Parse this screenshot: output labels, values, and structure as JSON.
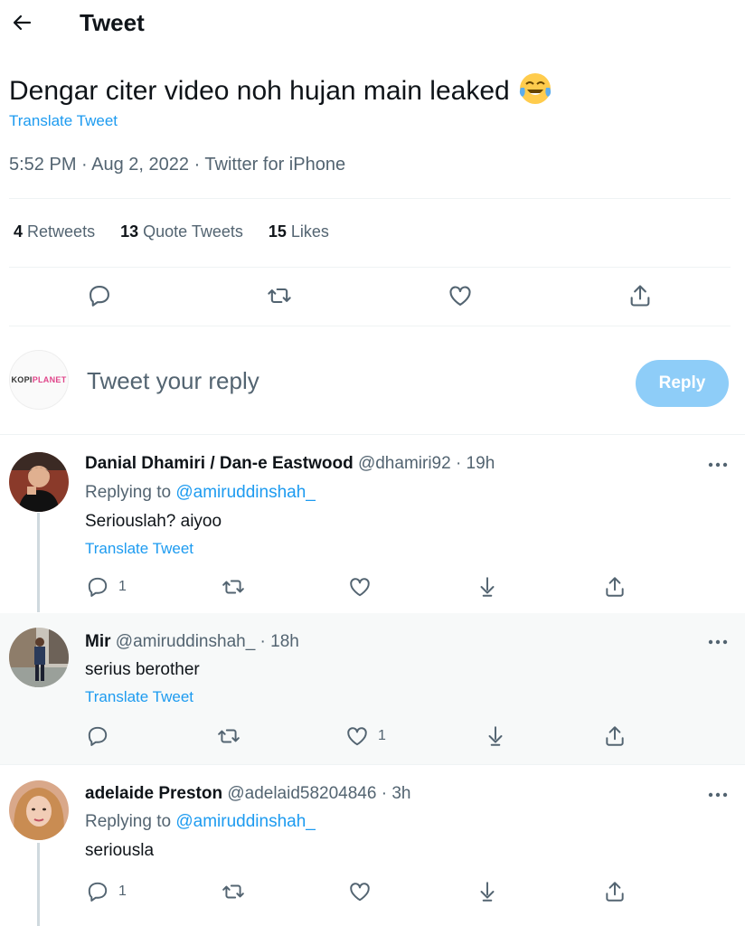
{
  "header": {
    "title": "Tweet",
    "back_icon": "arrow-left-icon"
  },
  "tweet": {
    "text": "Dengar citer video noh hujan main leaked",
    "emoji": "tears-of-joy-emoji",
    "translate": "Translate Tweet",
    "meta": "5:52 PM · Aug 2, 2022 · Twitter for iPhone",
    "stats": {
      "retweets_count": "4",
      "retweets_label": "Retweets",
      "quotes_count": "13",
      "quotes_label": "Quote Tweets",
      "likes_count": "15",
      "likes_label": "Likes"
    }
  },
  "reply_box": {
    "avatar_text_a": "KOPI",
    "avatar_text_b": "PLANET",
    "placeholder": "Tweet your reply",
    "button": "Reply"
  },
  "replies": [
    {
      "name": "Danial Dhamiri / Dan-e Eastwood",
      "handle": "@dhamiri92 · 19h",
      "replying_prefix": "Replying to ",
      "replying_to": "@amiruddinshah_",
      "text": "Seriouslah? aiyoo",
      "translate": "Translate Tweet",
      "reply_count": "1",
      "like_count": ""
    },
    {
      "name": "Mir",
      "handle": "@amiruddinshah_ · 18h",
      "text": "serius berother",
      "translate": "Translate Tweet",
      "reply_count": "",
      "like_count": "1"
    },
    {
      "name": "adelaide Preston",
      "handle": "@adelaid58204846 · 3h",
      "replying_prefix": "Replying to ",
      "replying_to": "@amiruddinshah_",
      "text": "seriousla",
      "reply_count": "1",
      "like_count": ""
    }
  ],
  "colors": {
    "link": "#1d9bf0",
    "secondary": "#536471",
    "reply_button": "#8ecdf8",
    "highlight_bg": "#f7f9f9"
  }
}
